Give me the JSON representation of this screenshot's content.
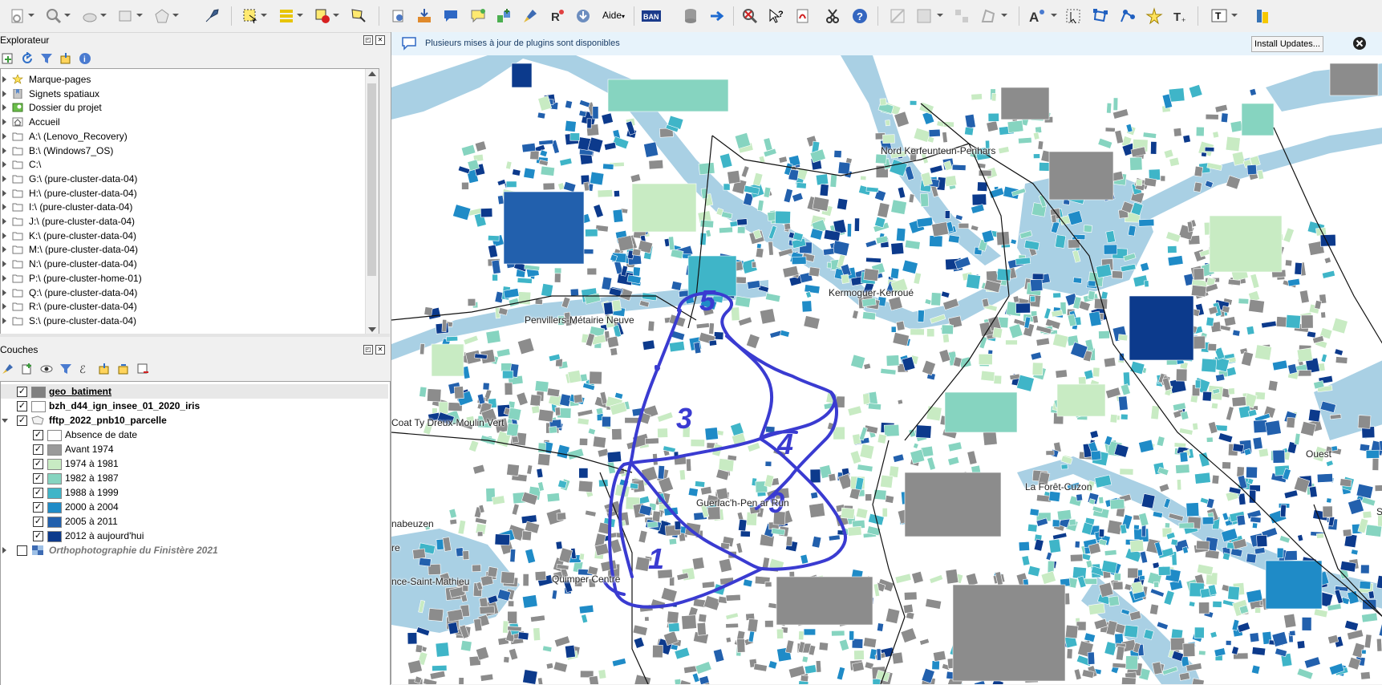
{
  "toolbar": {
    "aide_label": "Aide",
    "ban_label": "BAN",
    "icons": [
      "new-project-icon",
      "zoom-icon",
      "select-icon",
      "rocket-icon",
      "select-features-icon",
      "attribute-table-icon",
      "deselect-icon",
      "identify-icon",
      "add-layer-icon",
      "chat-icon",
      "annotation-icon",
      "plugin-icon",
      "brush-icon",
      "r-icon",
      "download-icon",
      "database-icon",
      "arrow-right-icon",
      "search-icon",
      "help-icon",
      "pdf-icon",
      "scissors-icon",
      "question-icon",
      "label-icon",
      "node-tool-icon",
      "star-icon",
      "text-icon",
      "python-icon"
    ]
  },
  "explorer": {
    "title": "Explorateur",
    "items": [
      {
        "label": "Marque-pages",
        "icon": "star-icon"
      },
      {
        "label": "Signets spatiaux",
        "icon": "bookmark-icon"
      },
      {
        "label": "Dossier du projet",
        "icon": "project-folder-icon"
      },
      {
        "label": "Accueil",
        "icon": "home-icon"
      },
      {
        "label": "A:\\ (Lenovo_Recovery)",
        "icon": "folder-icon"
      },
      {
        "label": "B:\\ (Windows7_OS)",
        "icon": "folder-icon"
      },
      {
        "label": "C:\\",
        "icon": "folder-icon"
      },
      {
        "label": "G:\\ (pure-cluster-data-04)",
        "icon": "folder-icon"
      },
      {
        "label": "H:\\ (pure-cluster-data-04)",
        "icon": "folder-icon"
      },
      {
        "label": "I:\\ (pure-cluster-data-04)",
        "icon": "folder-icon"
      },
      {
        "label": "J:\\ (pure-cluster-data-04)",
        "icon": "folder-icon"
      },
      {
        "label": "K:\\ (pure-cluster-data-04)",
        "icon": "folder-icon"
      },
      {
        "label": "M:\\ (pure-cluster-data-04)",
        "icon": "folder-icon"
      },
      {
        "label": "N:\\ (pure-cluster-data-04)",
        "icon": "folder-icon"
      },
      {
        "label": "P:\\ (pure-cluster-home-01)",
        "icon": "folder-icon"
      },
      {
        "label": "Q:\\ (pure-cluster-data-04)",
        "icon": "folder-icon"
      },
      {
        "label": "R:\\ (pure-cluster-data-04)",
        "icon": "folder-icon"
      },
      {
        "label": "S:\\ (pure-cluster-data-04)",
        "icon": "folder-icon"
      }
    ]
  },
  "layers": {
    "title": "Couches",
    "items": [
      {
        "label": "geo_batiment",
        "checked": true,
        "bold": true,
        "underline": true,
        "swatch": "#808080"
      },
      {
        "label": "bzh_d44_ign_insee_01_2020_iris",
        "checked": true,
        "bold": true,
        "swatch": "#ffffff"
      },
      {
        "label": "fftp_2022_pnb10_parcelle",
        "checked": true,
        "bold": true,
        "expanded": true,
        "swatch": "none"
      },
      {
        "label": "Absence de date",
        "checked": true,
        "child": true,
        "swatch": "#ffffff"
      },
      {
        "label": "Avant 1974",
        "checked": true,
        "child": true,
        "swatch": "#9a9a9a"
      },
      {
        "label": "1974 à 1981",
        "checked": true,
        "child": true,
        "swatch": "#c8ebc3"
      },
      {
        "label": "1982 à 1987",
        "checked": true,
        "child": true,
        "swatch": "#86d4c0"
      },
      {
        "label": "1988 à 1999",
        "checked": true,
        "child": true,
        "swatch": "#3fb5c8"
      },
      {
        "label": "2000 à 2004",
        "checked": true,
        "child": true,
        "swatch": "#1f8bc7"
      },
      {
        "label": "2005 à 2011",
        "checked": true,
        "child": true,
        "swatch": "#2260ad"
      },
      {
        "label": "2012 à aujourd'hui",
        "checked": true,
        "child": true,
        "swatch": "#0c3a8c"
      },
      {
        "label": "Orthophotographie du Finistère 2021",
        "checked": false,
        "italic": true,
        "swatch": "raster"
      }
    ]
  },
  "message_bar": {
    "text": "Plusieurs mises à jour de plugins sont disponibles",
    "button": "Install Updates..."
  },
  "map": {
    "places": [
      "Nord Kerfeunteun-Penhars",
      "Kermoguer-Kerroué",
      "Penvillers-Métairie Neuve",
      "Coat Ty Dreux-Moulin Vert",
      "Guerlac'h-Pen ar Run",
      "La Forêt-Cuzon",
      "Ouest",
      "nabeuzen",
      "Quimper Centre",
      "nce-Saint-Mathieu",
      "re",
      "S"
    ],
    "annotations": [
      "5",
      "3",
      "4",
      "9",
      "1"
    ],
    "colors": {
      "water": "#a9d0e4",
      "building_old": "#8c8c8c",
      "c1": "#c8ebc3",
      "c2": "#86d4c0",
      "c3": "#3fb5c8",
      "c4": "#1f8bc7",
      "c5": "#2260ad",
      "c6": "#0c3a8c",
      "annotation": "#3a3bd1"
    }
  }
}
